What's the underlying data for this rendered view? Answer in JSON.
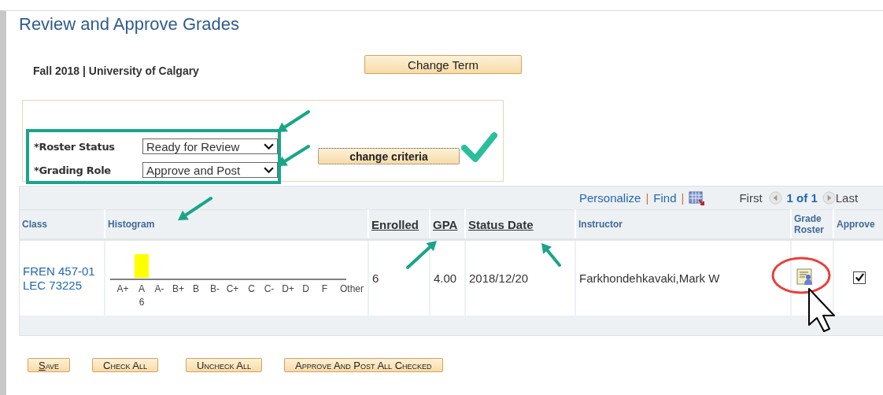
{
  "page": {
    "title": "Review and Approve Grades",
    "term": "Fall 2018 | University of Calgary",
    "change_term_button": "Change Term"
  },
  "criteria": {
    "fields": [
      {
        "label": "*Roster Status",
        "value": "Ready for Review"
      },
      {
        "label": "*Grading Role",
        "value": "Approve and Post"
      }
    ],
    "button": "change criteria"
  },
  "grid_toolbar": {
    "personalize": "Personalize",
    "separator_1": "|",
    "find": "Find",
    "separator_2": "|",
    "first": "First",
    "page": "1 of 1",
    "last": "Last"
  },
  "table": {
    "columns": [
      {
        "label": "Class",
        "sortable": false
      },
      {
        "label": "Histogram",
        "sortable": false
      },
      {
        "label": "Enrolled",
        "sortable": true
      },
      {
        "label": "GPA",
        "sortable": true
      },
      {
        "label": "Status Date",
        "sortable": true
      },
      {
        "label": "Instructor",
        "sortable": false
      },
      {
        "label": "Grade Roster",
        "sortable": false
      },
      {
        "label": "Approve",
        "sortable": false
      }
    ],
    "rows": [
      {
        "class_lines": [
          "FREN 457-01",
          "LEC 73225"
        ],
        "histogram": {
          "chart_data": {
            "type": "bar",
            "categories": [
              "A+",
              "A",
              "A-",
              "B+",
              "B",
              "B-",
              "C+",
              "C",
              "C-",
              "D+",
              "D",
              "F",
              "Other"
            ],
            "values": [
              0,
              6,
              0,
              0,
              0,
              0,
              0,
              0,
              0,
              0,
              0,
              0,
              0
            ],
            "value_labels": [
              null,
              "6",
              null,
              null,
              null,
              null,
              null,
              null,
              null,
              null,
              null,
              null,
              null
            ]
          }
        },
        "enrolled": "6",
        "gpa": "4.00",
        "status_date": "2018/12/20",
        "instructor": "Farkhondehkavaki,Mark W",
        "approve": true
      }
    ]
  },
  "buttons": [
    "Save",
    "Check All",
    "Uncheck All",
    "Approve And Post All Checked"
  ]
}
